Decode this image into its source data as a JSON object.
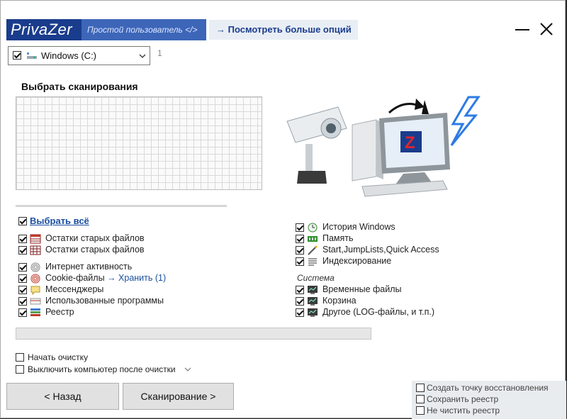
{
  "header": {
    "logo": "PrivaZer",
    "user_mode": "Простой пользователь </>",
    "more_options": "→ Посмотреть больше опций"
  },
  "drive": {
    "label": "Windows (C:)",
    "checked": true,
    "count": "1"
  },
  "scan": {
    "title": "Выбрать сканирования"
  },
  "select_all": "Выбрать всё",
  "left_items": [
    {
      "label": "Остатки старых файлов",
      "icon": "table-icon"
    },
    {
      "label": "Остатки старых файлов",
      "icon": "grid-icon"
    },
    {
      "label": "Интернет активность",
      "icon": "fingerprint-icon"
    },
    {
      "label": "Cookie-файлы",
      "link": "→ Хранить (1)",
      "icon": "cookie-fingerprint-icon"
    },
    {
      "label": "Мессенджеры",
      "icon": "chat-icon"
    },
    {
      "label": "Использованные программы",
      "icon": "programs-icon"
    },
    {
      "label": "Реестр",
      "icon": "registry-icon"
    }
  ],
  "right_items": [
    {
      "label": "История Windows",
      "icon": "clock-icon"
    },
    {
      "label": "Память",
      "icon": "memory-icon"
    },
    {
      "label": "Start,JumpLists,Quick Access",
      "icon": "wand-icon"
    },
    {
      "label": "Индексирование",
      "icon": "list-icon"
    }
  ],
  "system_label": "Система",
  "system_items": [
    {
      "label": "Временные файлы",
      "icon": "monitor-icon"
    },
    {
      "label": "Корзина",
      "icon": "monitor-icon"
    },
    {
      "label": "Другое (LOG-файлы, и т.п.)",
      "icon": "monitor-icon"
    }
  ],
  "options": {
    "start_clean": "Начать очистку",
    "shutdown": "Выключить компьютер после очистки"
  },
  "buttons": {
    "back": "< Назад",
    "scan": "Сканирование >"
  },
  "extra": {
    "restore_point": "Создать точку восстановления",
    "save_registry": "Сохранить реестр",
    "no_clean_registry": "Не чистить реестр"
  },
  "colors": {
    "brand": "#1a3c8c",
    "accent": "#3d66b8",
    "link": "#1a4fa0"
  }
}
